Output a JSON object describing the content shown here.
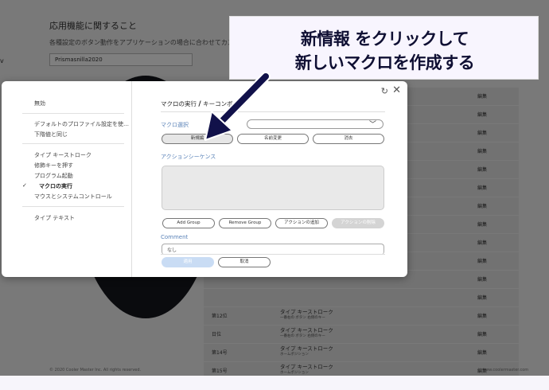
{
  "background": {
    "title": "応用機能に関すること",
    "subtitle": "各種設定のボタン動作をアプリケーションの場合に合わせてカス",
    "profile_value": "Prismasnilla2020",
    "left_chevron": "v",
    "rows": [
      {
        "c1": "",
        "c2": "",
        "c2_small": "",
        "c3": "編集"
      },
      {
        "c1": "",
        "c2": "",
        "c2_small": "",
        "c3": "編集"
      },
      {
        "c1": "",
        "c2": "",
        "c2_small": "",
        "c3": "編集"
      },
      {
        "c1": "",
        "c2": "",
        "c2_small": "",
        "c3": "編集"
      },
      {
        "c1": "",
        "c2": "",
        "c2_small": "",
        "c3": "編集"
      },
      {
        "c1": "",
        "c2": "",
        "c2_small": "",
        "c3": "編集"
      },
      {
        "c1": "",
        "c2": "",
        "c2_small": "",
        "c3": "編集"
      },
      {
        "c1": "",
        "c2": "",
        "c2_small": "",
        "c3": "編集"
      },
      {
        "c1": "",
        "c2": "",
        "c2_small": "",
        "c3": "編集"
      },
      {
        "c1": "",
        "c2": "",
        "c2_small": "",
        "c3": "編集"
      },
      {
        "c1": "",
        "c2": "",
        "c2_small": "",
        "c3": "編集"
      },
      {
        "c1": "",
        "c2": "",
        "c2_small": "",
        "c3": "編集"
      },
      {
        "c1": "第12位",
        "c2": "タイプ キーストローク",
        "c2_small": "一番右の ボタン 右側のキー",
        "c3": "編集"
      },
      {
        "c1": "日位",
        "c2": "タイプ キーストローク",
        "c2_small": "一番右の ボタン 右側のキー",
        "c3": "編集"
      },
      {
        "c1": "第14号",
        "c2": "タイプ キーストローク",
        "c2_small": "ホームポジション",
        "c3": "編集"
      },
      {
        "c1": "第15号",
        "c2": "タイプ キーストローク",
        "c2_small": "ホームポジション",
        "c3": "編集"
      }
    ],
    "footer_left": "© 2020 Cooler Master Inc. All rights reserved.",
    "footer_right": "www.coolermaster.com"
  },
  "modal": {
    "refresh_icon": "↻",
    "close_icon": "✕",
    "sidebar": {
      "items": [
        {
          "label": "無効"
        },
        {
          "label": "デフォルトのプロファイル設定を使…"
        },
        {
          "label": "下階値と同じ"
        },
        {
          "label": "タイプ キーストローク"
        },
        {
          "label": "修飾キーを押す"
        },
        {
          "label": "プログラム起動"
        },
        {
          "label": "マクロの実行"
        },
        {
          "label": "マウスとシステムコントロール"
        },
        {
          "label": "タイプ テキスト"
        }
      ],
      "checkmark": "✓"
    },
    "title_left": "マクロの実行",
    "title_sep": "/",
    "title_right": "キーコンボ",
    "macro_select_label": "マクロ選択",
    "macro_select_chevron": "﹀",
    "buttons": {
      "new": "新規編",
      "rename": "名前変更",
      "delete": "消去"
    },
    "action_sequence_label": "アクションシーケンス",
    "action_buttons": {
      "add_group": "Add Group",
      "remove_group": "Remove Group",
      "add_action": "アクションの追加",
      "delete_action": "アクションの削除"
    },
    "comment_label": "Comment",
    "comment_value": "なし",
    "apply": "適用",
    "cancel": "取消"
  },
  "callout": {
    "line1": "新情報 をクリックして",
    "line2": "新しいマクロを作成する"
  },
  "colors": {
    "accent_label": "#5b83b8",
    "callout_text": "#0f0f33",
    "arrow": "#11114a",
    "primary_button": "#c9dcf4"
  }
}
